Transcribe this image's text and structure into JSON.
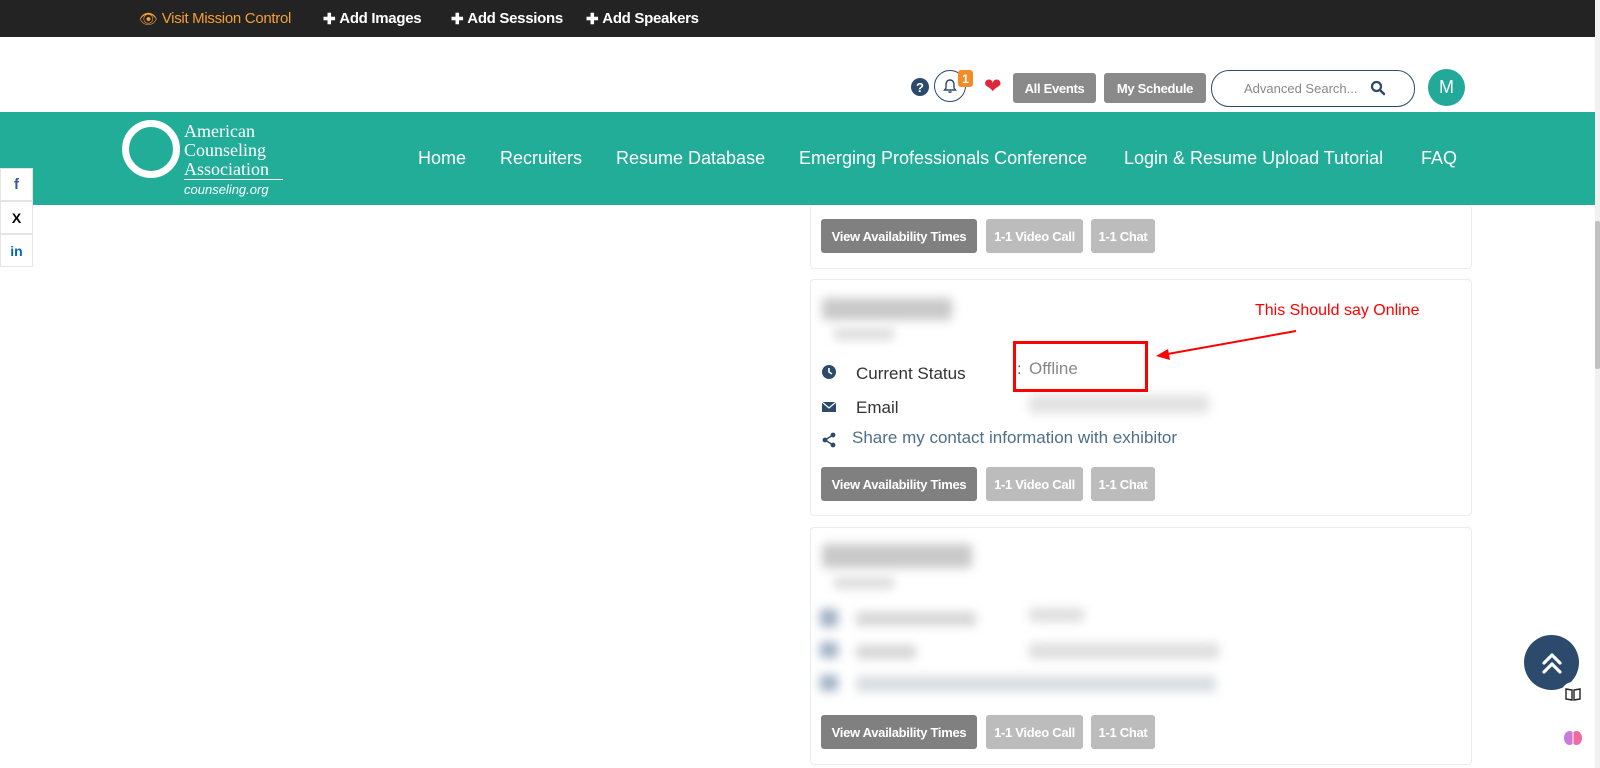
{
  "admin_bar": {
    "links": [
      {
        "label": "Visit Mission Control",
        "icon": "eye-icon"
      },
      {
        "label": "Add Images",
        "icon": "plus-icon"
      },
      {
        "label": "Add Sessions",
        "icon": "plus-icon"
      },
      {
        "label": "Add Speakers",
        "icon": "plus-icon"
      }
    ]
  },
  "utility": {
    "notification_count": "1",
    "all_events_label": "All Events",
    "my_schedule_label": "My Schedule",
    "search_placeholder": "Advanced Search...",
    "avatar_initial": "M"
  },
  "logo": {
    "line1": "American",
    "line2": "Counseling",
    "line3": "Association",
    "url": "counseling.org"
  },
  "nav": {
    "items": [
      "Home",
      "Recruiters",
      "Resume Database",
      "Emerging Professionals Conference",
      "Login & Resume Upload Tutorial",
      "FAQ"
    ]
  },
  "social": {
    "facebook": "f",
    "x": "X",
    "linkedin": "in"
  },
  "cards": {
    "view_availability_label": "View Availability Times",
    "video_call_label": "1-1 Video Call",
    "chat_label": "1-1 Chat",
    "current_status_label": "Current Status",
    "colon": ":",
    "status_value": "Offline",
    "email_label": "Email",
    "share_label": "Share my contact information with exhibitor"
  },
  "annotation": {
    "text": "This Should say Online",
    "color": "#ff0000"
  },
  "colors": {
    "teal": "#22ad99",
    "navy": "#2c4a6b",
    "admin_bg": "#232323",
    "orange": "#f5a033"
  }
}
